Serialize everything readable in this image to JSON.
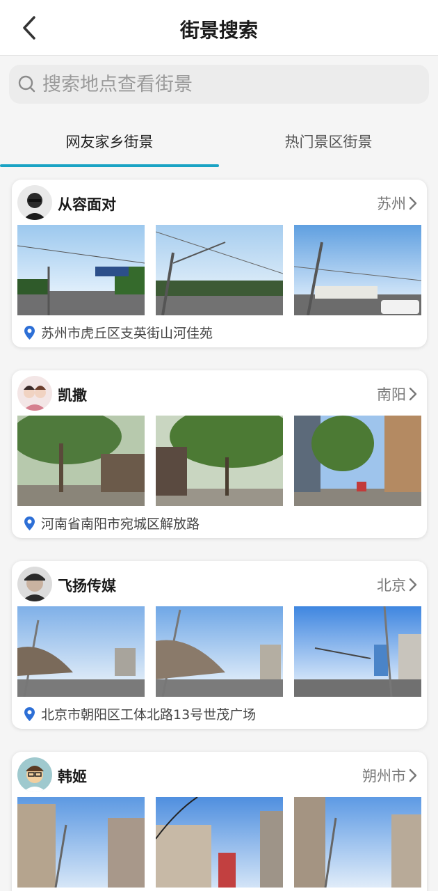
{
  "header": {
    "title": "街景搜索"
  },
  "search": {
    "placeholder": "搜索地点查看街景"
  },
  "tabs": [
    {
      "label": "网友家乡街景",
      "active": true
    },
    {
      "label": "热门景区街景",
      "active": false
    }
  ],
  "accent_color": "#1aa3c4",
  "pin_color": "#2d6fd6",
  "cards": [
    {
      "user": "从容面对",
      "city": "苏州",
      "address": "苏州市虎丘区支英街山河佳苑"
    },
    {
      "user": "凯撒",
      "city": "南阳",
      "address": "河南省南阳市宛城区解放路"
    },
    {
      "user": "飞扬传媒",
      "city": "北京",
      "address": "北京市朝阳区工体北路13号世茂广场"
    },
    {
      "user": "韩姬",
      "city": "朔州市",
      "address": ""
    }
  ]
}
